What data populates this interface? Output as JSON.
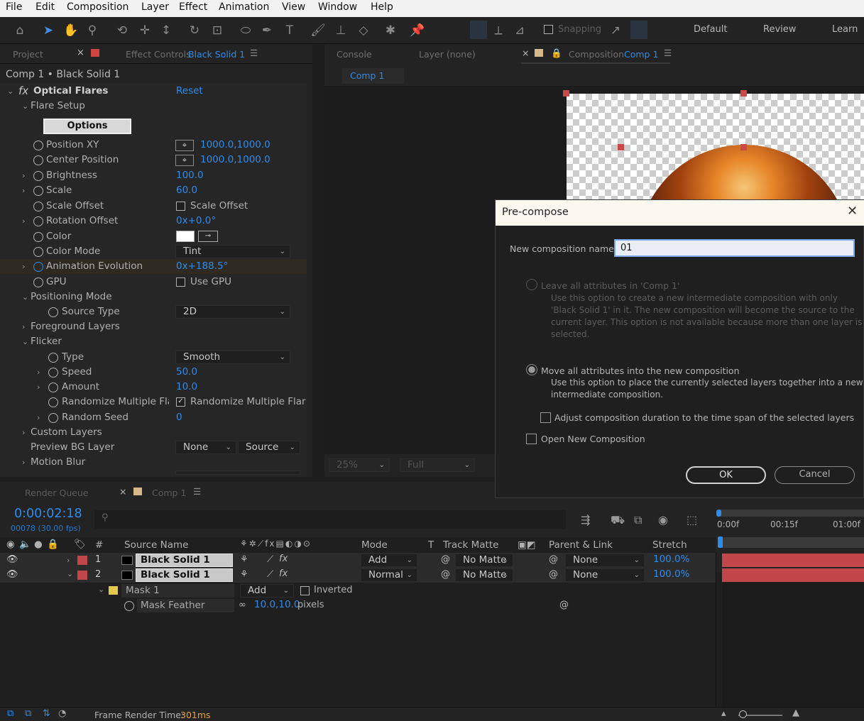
{
  "menu": [
    "File",
    "Edit",
    "Composition",
    "Layer",
    "Effect",
    "Animation",
    "View",
    "Window",
    "Help"
  ],
  "toolbar": {
    "snapping": "Snapping",
    "workspaces": [
      "Default",
      "Review",
      "Learn"
    ]
  },
  "left_panel": {
    "tab_project": "Project",
    "tab_effect_prefix": "Effect Controls",
    "tab_effect_layer": "Black Solid 1",
    "breadcrumb": "Comp 1 • Black Solid 1",
    "effect_name": "Optical Flares",
    "reset": "Reset",
    "flare_setup": "Flare Setup",
    "options_btn": "Options",
    "position_xy": {
      "label": "Position XY",
      "value": "1000.0,1000.0"
    },
    "center_position": {
      "label": "Center Position",
      "value": "1000.0,1000.0"
    },
    "brightness": {
      "label": "Brightness",
      "value": "100.0"
    },
    "scale": {
      "label": "Scale",
      "value": "60.0"
    },
    "scale_offset": {
      "label": "Scale Offset",
      "value": "Scale Offset"
    },
    "rotation_offset": {
      "label": "Rotation Offset",
      "value": "0x+0.0°"
    },
    "color": {
      "label": "Color"
    },
    "color_mode": {
      "label": "Color Mode",
      "value": "Tint"
    },
    "anim_evolution": {
      "label": "Animation Evolution",
      "value": "0x+188.5°"
    },
    "gpu": {
      "label": "GPU",
      "value": "Use GPU"
    },
    "positioning_mode": "Positioning Mode",
    "source_type": {
      "label": "Source Type",
      "value": "2D"
    },
    "foreground_layers": "Foreground Layers",
    "flicker": "Flicker",
    "type": {
      "label": "Type",
      "value": "Smooth"
    },
    "speed": {
      "label": "Speed",
      "value": "50.0"
    },
    "amount": {
      "label": "Amount",
      "value": "10.0"
    },
    "randomize": {
      "label": "Randomize Multiple Flar",
      "value": "Randomize Multiple Flar"
    },
    "random_seed": {
      "label": "Random Seed",
      "value": "0"
    },
    "custom_layers": "Custom Layers",
    "preview_bg": {
      "label": "Preview BG Layer",
      "value1": "None",
      "value2": "Source"
    },
    "motion_blur": "Motion Blur"
  },
  "comp_panel": {
    "tab_console": "Console",
    "tab_layer": "Layer (none)",
    "tab_comp_prefix": "Composition",
    "tab_comp": "Comp 1",
    "comp_chip": "Comp 1",
    "zoom": "25%",
    "resolution": "Full"
  },
  "dialog": {
    "title": "Pre-compose",
    "name_label": "New composition name:",
    "name_value": "01",
    "opt1_title": "Leave all attributes in 'Comp 1'",
    "opt1_desc": [
      "Use this option to create a new intermediate composition with only",
      "'Black Solid 1' in it. The new composition will become the source to the",
      "current layer. This option is not available because more than one layer is",
      "selected."
    ],
    "opt2_title": "Move all attributes into the new composition",
    "opt2_desc": [
      "Use this option to place the currently selected layers together into a new",
      "intermediate composition."
    ],
    "adjust": "Adjust composition duration to the time span of the selected layers",
    "open_new": "Open New Composition",
    "ok": "OK",
    "cancel": "Cancel"
  },
  "timeline": {
    "tab_render": "Render Queue",
    "tab_comp": "Comp 1",
    "timecode": "0:00:02:18",
    "frames": "00078 (30.00 fps)",
    "headers": {
      "num": "#",
      "source": "Source Name",
      "mode": "Mode",
      "t": "T",
      "track": "Track Matte",
      "parent": "Parent & Link",
      "stretch": "Stretch"
    },
    "ruler": [
      "0:00f",
      "00:15f",
      "01:00f"
    ],
    "layers": [
      {
        "num": "1",
        "name": "Black Solid 1",
        "mode": "Add",
        "matte": "No Matte",
        "parent": "None",
        "stretch": "100.0%"
      },
      {
        "num": "2",
        "name": "Black Solid 1",
        "mode": "Normal",
        "matte": "No Matte",
        "parent": "None",
        "stretch": "100.0%"
      }
    ],
    "mask": {
      "name": "Mask 1",
      "mode": "Add",
      "inverted": "Inverted",
      "feather_label": "Mask Feather",
      "feather_value": "10.0,10.0",
      "feather_unit": "pixels"
    },
    "status_label": "Frame Render Time:",
    "status_value": "301ms"
  },
  "colors": {
    "accent": "#2d8ceb",
    "layer_red": "#c0464a",
    "mask_yellow": "#e8c84a"
  }
}
